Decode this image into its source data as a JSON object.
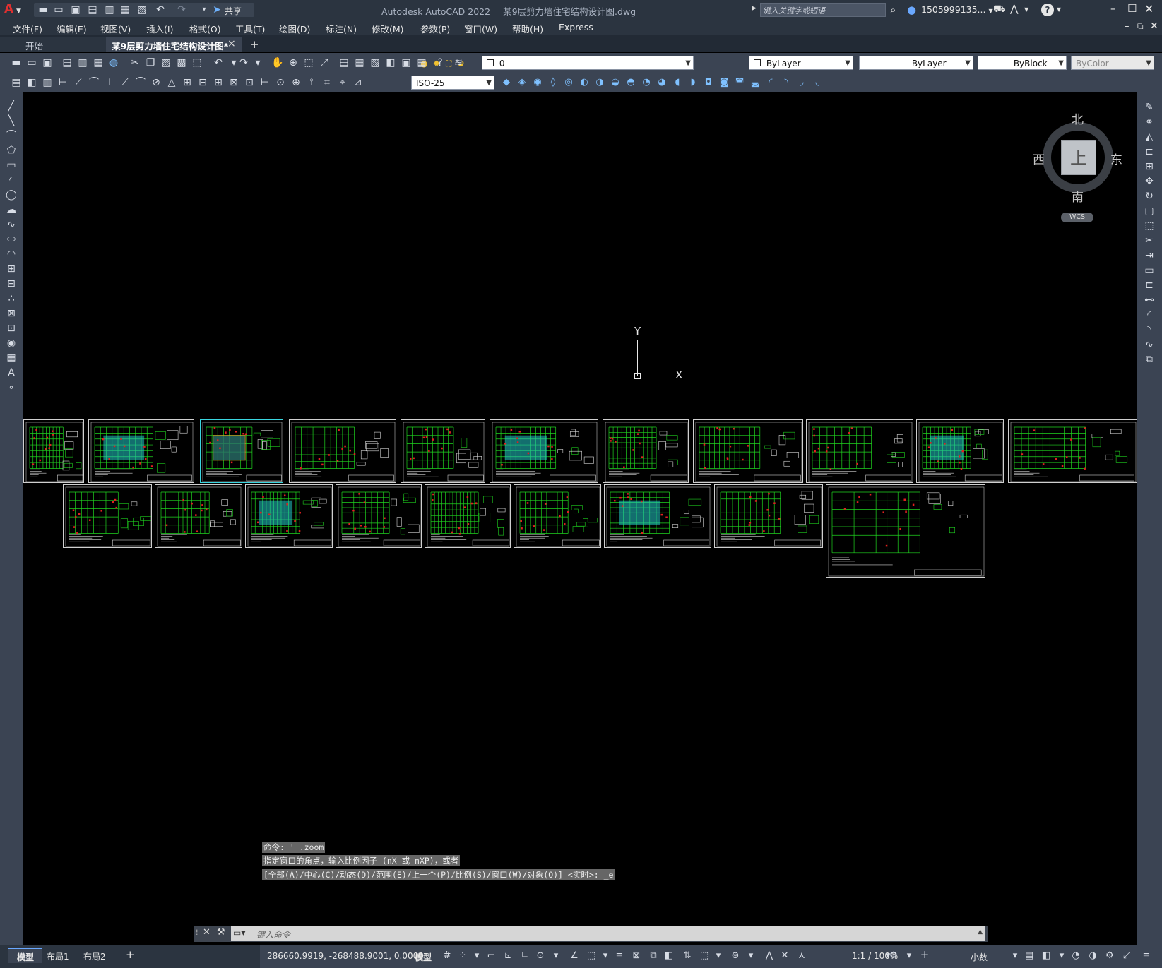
{
  "title_bar": {
    "app_letter": "A",
    "share_label": "共享",
    "app_title": "Autodesk AutoCAD 2022",
    "file_title": "某9层剪力墙住宅结构设计图.dwg",
    "search_placeholder": "键入关键字或短语",
    "user_name": "1505999135...",
    "help": "?"
  },
  "menu": [
    "文件(F)",
    "编辑(E)",
    "视图(V)",
    "插入(I)",
    "格式(O)",
    "工具(T)",
    "绘图(D)",
    "标注(N)",
    "修改(M)",
    "参数(P)",
    "窗口(W)",
    "帮助(H)",
    "Express"
  ],
  "tabs": {
    "start": "开始",
    "active": "某9层剪力墙住宅结构设计图*",
    "close": "×",
    "add": "+"
  },
  "layer_combo": "0",
  "color_combo": "ByLayer",
  "linetype_combo": "ByLayer",
  "lineweight_combo": "ByBlock",
  "plotstyle_combo": "ByColor",
  "dimstyle_combo": "ISO-25",
  "viewcube": {
    "north": "北",
    "south": "南",
    "east": "东",
    "west": "西",
    "top": "上",
    "wcs": "WCS"
  },
  "ucs": {
    "x": "X",
    "y": "Y"
  },
  "command_history": [
    "命令: '_.zoom",
    "指定窗口的角点，输入比例因子 (nX 或 nXP)，或者",
    "[全部(A)/中心(C)/动态(D)/范围(E)/上一个(P)/比例(S)/窗口(W)/对象(O)] <实时>: _e"
  ],
  "command_placeholder": "键入命令",
  "layout_tabs": [
    "模型",
    "布局1",
    "布局2"
  ],
  "layout_add": "+",
  "status": {
    "coords": "286660.9919, -268488.9001, 0.0000",
    "mode": "模型",
    "scale": "1:1 / 100%",
    "units": "小数"
  },
  "colors": {
    "drawing_green": "#1fd41f",
    "drawing_red": "#e22020",
    "drawing_cyan": "#22c8c8",
    "sheet_border": "#d0d0d0",
    "selected_border": "#3ad6e0"
  }
}
